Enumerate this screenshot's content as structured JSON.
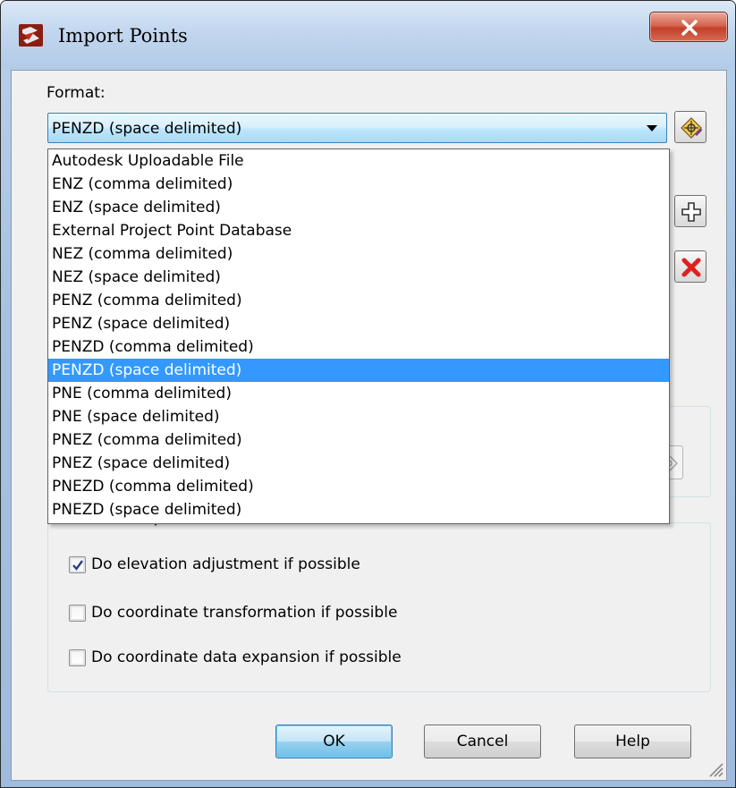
{
  "window": {
    "title": "Import Points",
    "close_label": "x"
  },
  "format": {
    "label": "Format:",
    "selected": "PENZD (space delimited)",
    "options": [
      "Autodesk Uploadable File",
      "ENZ (comma delimited)",
      "ENZ (space delimited)",
      "External Project Point Database",
      "NEZ (comma delimited)",
      "NEZ (space delimited)",
      "PENZ (comma delimited)",
      "PENZ (space delimited)",
      "PENZD (comma delimited)",
      "PENZD (space delimited)",
      "PNE (comma delimited)",
      "PNE (space delimited)",
      "PNEZ (comma delimited)",
      "PNEZ (space delimited)",
      "PNEZD (comma delimited)",
      "PNEZD (space delimited)"
    ],
    "selected_index": 9
  },
  "advanced": {
    "title": "Advanced options",
    "options": [
      {
        "label": "Do elevation adjustment if possible",
        "checked": true
      },
      {
        "label": "Do coordinate transformation if possible",
        "checked": false
      },
      {
        "label": "Do coordinate data expansion if possible",
        "checked": false
      }
    ]
  },
  "buttons": {
    "ok": "OK",
    "cancel": "Cancel",
    "help": "Help"
  },
  "colors": {
    "selection": "#3399ff",
    "close_red": "#c2402a",
    "delete_red": "#e02020"
  }
}
